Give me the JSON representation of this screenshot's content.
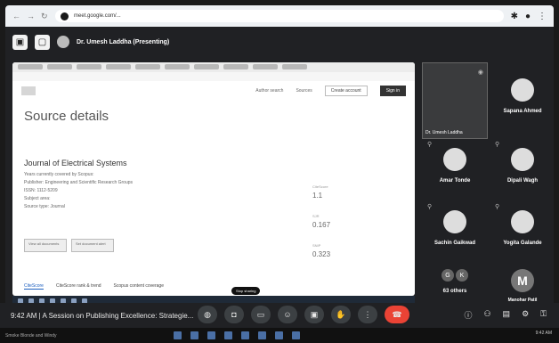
{
  "browser": {
    "url": "meet.google.com/..."
  },
  "meet": {
    "presenter_label": "Dr. Umesh Laddha (Presenting)"
  },
  "shared_screen": {
    "header": {
      "author_search": "Author search",
      "sources": "Sources",
      "create_account": "Create account",
      "sign_in": "Sign in"
    },
    "page_title": "Source details",
    "journal_title": "Journal of Electrical Systems",
    "meta": {
      "coverage": "Years currently covered by Scopus:",
      "publisher": "Publisher: Engineering and Scientific Research Groups",
      "issn": "ISSN: 1112-5209",
      "subject_area": "Subject area:",
      "source_type": "Source type: Journal"
    },
    "metrics": [
      {
        "label": "CiteScore",
        "value": "1.1"
      },
      {
        "label": "SJR",
        "value": "0.167"
      },
      {
        "label": "SNIP",
        "value": "0.323"
      }
    ],
    "badges": [
      "View all documents",
      "Set document alert"
    ],
    "tabs": [
      "CiteScore",
      "CiteScore rank & trend",
      "Scopus content coverage"
    ],
    "stop_sharing": "Stop sharing"
  },
  "participants": {
    "self_label": "Dr. Umesh Laddha",
    "tiles": [
      {
        "name": "Sapana Ahmed"
      },
      {
        "name": "Amar Tonde"
      },
      {
        "name": "Dipali Wagh"
      },
      {
        "name": "Sachin Gaikwad"
      },
      {
        "name": "Yogita Galande"
      },
      {
        "name": "63 others",
        "initials": [
          "G",
          "K"
        ]
      },
      {
        "name": "Manohar Patil",
        "initials": "M"
      }
    ]
  },
  "controls": {
    "time": "9:42 AM",
    "separator": "|",
    "meeting_name": "A Session on Publishing Excellence: Strategie..."
  },
  "taskbar": {
    "weather": "Smoke Blonde and Windy",
    "time": "9:42 AM"
  }
}
